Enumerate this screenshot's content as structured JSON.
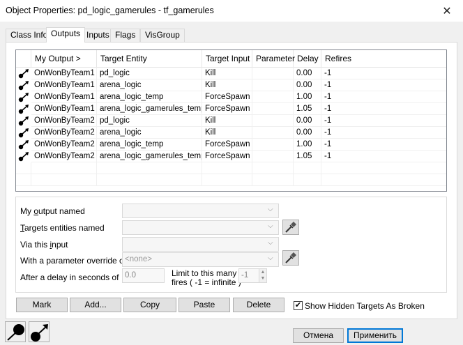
{
  "window": {
    "title": "Object Properties: pd_logic_gamerules - tf_gamerules",
    "close_label": "✕"
  },
  "tabs": [
    {
      "label": "Class Info"
    },
    {
      "label": "Outputs"
    },
    {
      "label": "Inputs"
    },
    {
      "label": "Flags"
    },
    {
      "label": "VisGroup"
    }
  ],
  "grid": {
    "columns": [
      "My Output  >",
      "Target Entity",
      "Target Input",
      "Parameter",
      "Delay",
      "Refires"
    ],
    "rows": [
      {
        "output": "OnWonByTeam1",
        "target": "pd_logic",
        "input": "Kill",
        "param": "",
        "delay": "0.00",
        "refires": "-1"
      },
      {
        "output": "OnWonByTeam1",
        "target": "arena_logic",
        "input": "Kill",
        "param": "",
        "delay": "0.00",
        "refires": "-1"
      },
      {
        "output": "OnWonByTeam1",
        "target": "arena_logic_temp",
        "input": "ForceSpawn",
        "param": "",
        "delay": "1.00",
        "refires": "-1"
      },
      {
        "output": "OnWonByTeam1",
        "target": "arena_logic_gamerules_temp",
        "input": "ForceSpawn",
        "param": "",
        "delay": "1.05",
        "refires": "-1"
      },
      {
        "output": "OnWonByTeam2",
        "target": "pd_logic",
        "input": "Kill",
        "param": "",
        "delay": "0.00",
        "refires": "-1"
      },
      {
        "output": "OnWonByTeam2",
        "target": "arena_logic",
        "input": "Kill",
        "param": "",
        "delay": "0.00",
        "refires": "-1"
      },
      {
        "output": "OnWonByTeam2",
        "target": "arena_logic_temp",
        "input": "ForceSpawn",
        "param": "",
        "delay": "1.00",
        "refires": "-1"
      },
      {
        "output": "OnWonByTeam2",
        "target": "arena_logic_gamerules_temp",
        "input": "ForceSpawn",
        "param": "",
        "delay": "1.05",
        "refires": "-1"
      }
    ]
  },
  "editor": {
    "output_label_pre": "My ",
    "output_label_u": "o",
    "output_label_post": "utput named",
    "targets_label_u": "T",
    "targets_label_post": "argets entities named",
    "via_label_pre": "Via this ",
    "via_label_u": "i",
    "via_label_post": "nput",
    "param_label": "With a parameter override of",
    "param_value": "<none>",
    "delay_label": "After a delay in seconds of",
    "delay_value": "0.0",
    "limit_line1": "Limit to this many",
    "limit_line2": "fires  ( -1 = infinite )",
    "limit_value": "-1",
    "spin_up": "▲",
    "spin_down": "▼"
  },
  "buttons": {
    "mark": "Mark",
    "add": "Add...",
    "copy": "Copy",
    "paste": "Paste",
    "delete": "Delete",
    "show_hidden": "Show Hidden Targets As Broken",
    "show_hidden_checked": "✔",
    "cancel": "Отмена",
    "apply": "Применить"
  },
  "colors": {
    "accent": "#0078d7"
  }
}
